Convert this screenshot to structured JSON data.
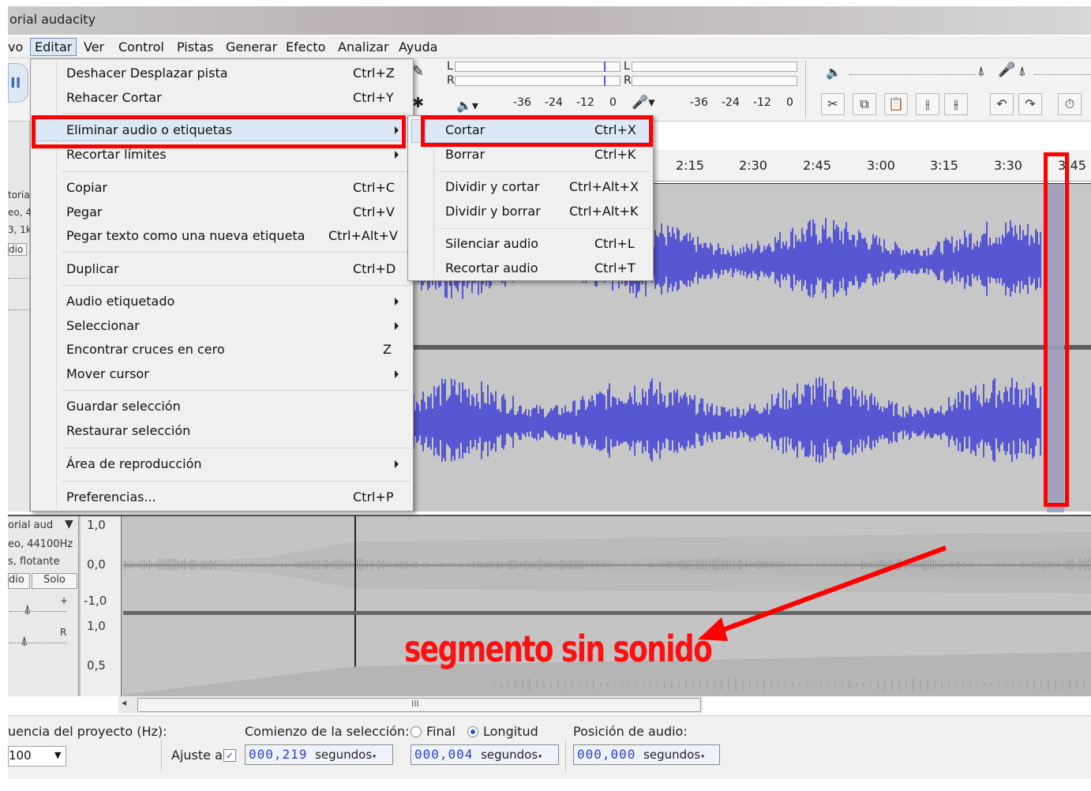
{
  "window": {
    "title": "orial audacity"
  },
  "menubar": {
    "items": [
      "vo",
      "Editar",
      "Ver",
      "Control",
      "Pistas",
      "Generar",
      "Efecto",
      "Analizar",
      "Ayuda"
    ]
  },
  "toolbar": {
    "meter_play_L": "L",
    "meter_play_R": "R",
    "meter_rec_L": "L",
    "meter_rec_R": "R",
    "scale_play": [
      "-36",
      "-24",
      "-12",
      "0"
    ],
    "scale_rec": [
      "-36",
      "-24",
      "-12",
      "0"
    ]
  },
  "ruler": {
    "ticks": [
      "2:15",
      "2:30",
      "2:45",
      "3:00",
      "3:15",
      "3:30",
      "3:45"
    ]
  },
  "left_panel_fragments": [
    "toria",
    "eo, 4",
    "3, 1k",
    "dio"
  ],
  "edit_menu": {
    "items": [
      {
        "label": "Deshacer Desplazar pista",
        "shortcut": "Ctrl+Z"
      },
      {
        "label": "Rehacer Cortar",
        "shortcut": "Ctrl+Y"
      },
      {
        "label": "Eliminar audio o etiquetas",
        "shortcut": ""
      },
      {
        "label": "Recortar límites",
        "shortcut": ""
      },
      {
        "label": "Copiar",
        "shortcut": "Ctrl+C"
      },
      {
        "label": "Pegar",
        "shortcut": "Ctrl+V"
      },
      {
        "label": "Pegar texto como una nueva etiqueta",
        "shortcut": "Ctrl+Alt+V"
      },
      {
        "label": "Duplicar",
        "shortcut": "Ctrl+D"
      },
      {
        "label": "Audio etiquetado",
        "shortcut": ""
      },
      {
        "label": "Seleccionar",
        "shortcut": ""
      },
      {
        "label": "Encontrar cruces en cero",
        "shortcut": "Z"
      },
      {
        "label": "Mover cursor",
        "shortcut": ""
      },
      {
        "label": "Guardar selección",
        "shortcut": ""
      },
      {
        "label": "Restaurar selección",
        "shortcut": ""
      },
      {
        "label": "Área de reproducción",
        "shortcut": ""
      },
      {
        "label": "Preferencias...",
        "shortcut": "Ctrl+P"
      }
    ]
  },
  "submenu": {
    "items": [
      {
        "label": "Cortar",
        "shortcut": "Ctrl+X"
      },
      {
        "label": "Borrar",
        "shortcut": "Ctrl+K"
      },
      {
        "label": "Dividir y cortar",
        "shortcut": "Ctrl+Alt+X"
      },
      {
        "label": "Dividir y borrar",
        "shortcut": "Ctrl+Alt+K"
      },
      {
        "label": "Silenciar audio",
        "shortcut": "Ctrl+L"
      },
      {
        "label": "Recortar audio",
        "shortcut": "Ctrl+T"
      }
    ]
  },
  "track2": {
    "name": "orial aud",
    "info1": "eo, 44100Hz",
    "info2": "s, flotante",
    "mute": "dio",
    "solo": "Solo",
    "pan_R": "R",
    "gain_plus": "+",
    "scale": [
      "1,0",
      "0,0",
      "-1,0",
      "1,0",
      "0,5"
    ]
  },
  "annotation": {
    "text": "segmento sin sonido"
  },
  "scrollbar": {
    "thumb_glyph": "III"
  },
  "selection_bar": {
    "rate_label": "uencia del proyecto (Hz):",
    "rate_value": "100",
    "snap_label": "Ajuste a",
    "start_label": "Comienzo de la selección:",
    "radio_final": "Final",
    "radio_length": "Longitud",
    "audio_pos_label": "Posición de audio:",
    "start_digits": "000,219",
    "start_unit": "segundos",
    "length_digits": "000,004",
    "length_unit": "segundos",
    "pos_digits": "000,000",
    "pos_unit": "segundos"
  },
  "colors": {
    "waveform": "#3b3bd6",
    "track_bg": "#c7c7c7",
    "highlight": "#ff0000",
    "annotation": "#ff1010"
  }
}
